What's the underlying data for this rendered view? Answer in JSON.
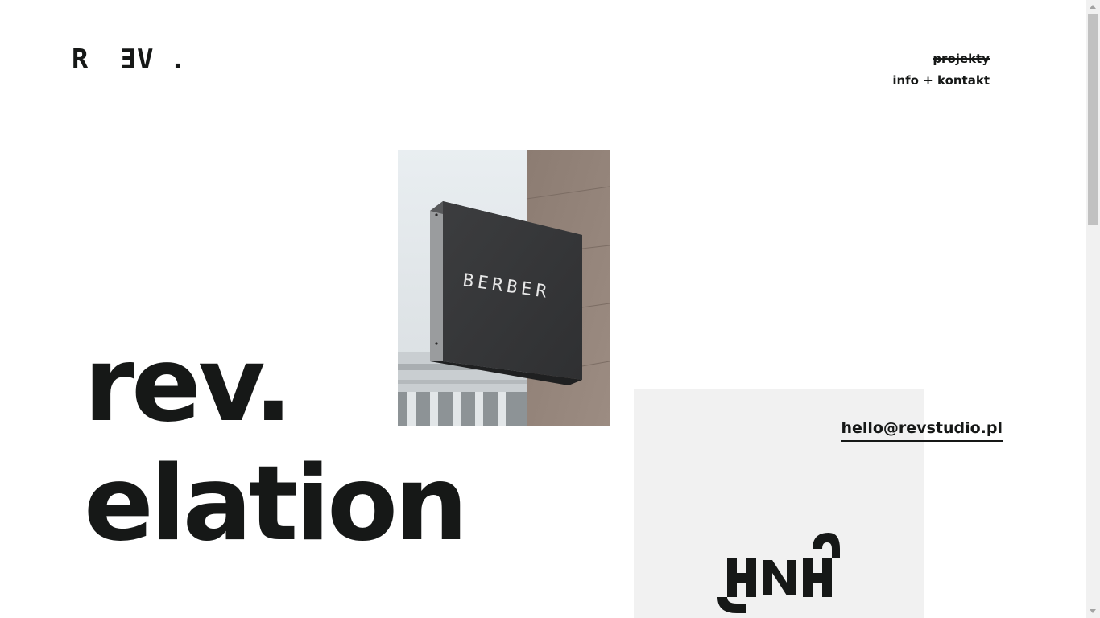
{
  "logo": {
    "letters": [
      "R",
      "E",
      "V",
      "."
    ],
    "label": "REV."
  },
  "nav": {
    "items": [
      {
        "label": "projekty",
        "active": true
      },
      {
        "label": "info + kontakt",
        "active": false
      }
    ]
  },
  "hero": {
    "line1": "rev.",
    "line2": "elation"
  },
  "sign_photo": {
    "sign_text": "BERBER"
  },
  "brand_card": {
    "mark_text": "HNH"
  },
  "contact": {
    "email": "hello@revstudio.pl"
  },
  "colors": {
    "text": "#161817",
    "background": "#ffffff",
    "card": "#f1f1f1",
    "wall": "#8f7f76"
  },
  "icons": {
    "scroll_up": "chevron-up-icon",
    "scroll_down": "chevron-down-icon"
  }
}
